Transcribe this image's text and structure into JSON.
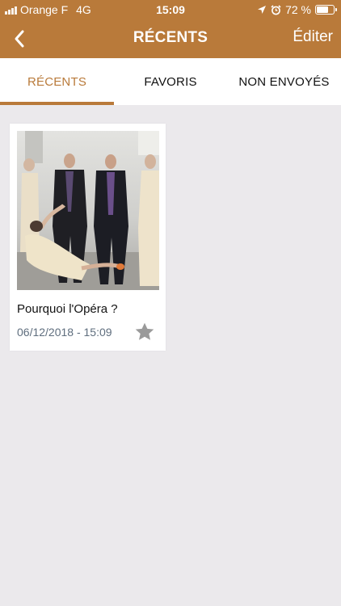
{
  "status_bar": {
    "carrier": "Orange F",
    "network": "4G",
    "time": "15:09",
    "battery": "72 %",
    "battery_level": 0.72
  },
  "nav": {
    "title": "RÉCENTS",
    "edit_label": "Éditer"
  },
  "tabs": [
    {
      "label": "RÉCENTS",
      "active": true
    },
    {
      "label": "FAVORIS",
      "active": false
    },
    {
      "label": "NON ENVOYÉS",
      "active": false
    }
  ],
  "items": [
    {
      "title": "Pourquoi l'Opéra ?",
      "date": "06/12/2018 - 15:09",
      "favorite": false
    }
  ],
  "colors": {
    "accent": "#b97a3a",
    "background": "#ebe9ec",
    "date_text": "#5f6e7e",
    "star_inactive": "#9a9a9a"
  }
}
